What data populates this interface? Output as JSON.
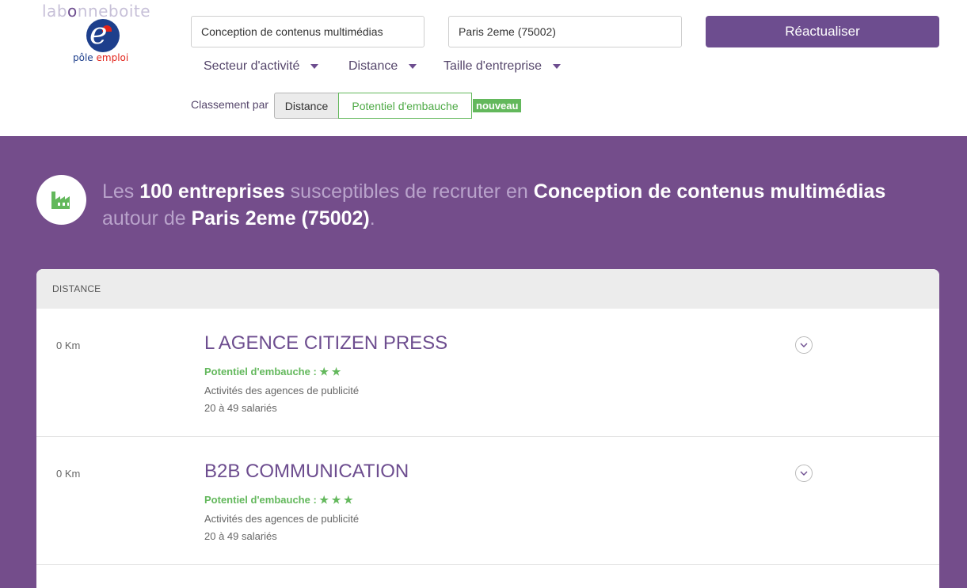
{
  "brand": {
    "name_prefix": "lab",
    "name_o": "o",
    "name_suffix": "nneboite",
    "logo_e": "e",
    "logo_label_1": "pôle ",
    "logo_label_2": "emploi"
  },
  "search": {
    "job_value": "Conception de contenus multimédias",
    "location_value": "Paris 2eme (75002)",
    "refresh_label": "Réactualiser"
  },
  "filters": {
    "sector": "Secteur d'activité",
    "distance": "Distance",
    "size": "Taille d'entreprise"
  },
  "sort": {
    "label": "Classement par",
    "distance": "Distance",
    "potential": "Potentiel d'embauche",
    "new_badge": "nouveau"
  },
  "headline": {
    "part1": "Les ",
    "count": "100 entreprises",
    "part2": " susceptibles de recruter en ",
    "job": "Conception de contenus multimédias",
    "part3": "autour de ",
    "location": "Paris 2eme (75002)",
    "part4": "."
  },
  "results": {
    "column_header": "DISTANCE",
    "items": [
      {
        "distance": "0 Km",
        "name": "L AGENCE CITIZEN PRESS",
        "potential_label": "Potentiel d'embauche :",
        "stars": 2,
        "activity": "Activités des agences de publicité",
        "size": "20 à 49 salariés"
      },
      {
        "distance": "0 Km",
        "name": "B2B COMMUNICATION",
        "potential_label": "Potentiel d'embauche :",
        "stars": 3,
        "activity": "Activités des agences de publicité",
        "size": "20 à 49 salariés"
      }
    ]
  },
  "colors": {
    "purple": "#744d8b",
    "green": "#63b85c",
    "button": "#6d4d8f"
  },
  "icons": [
    "factory-icon",
    "star-icon",
    "chevron-down-icon",
    "caret-down-icon"
  ]
}
